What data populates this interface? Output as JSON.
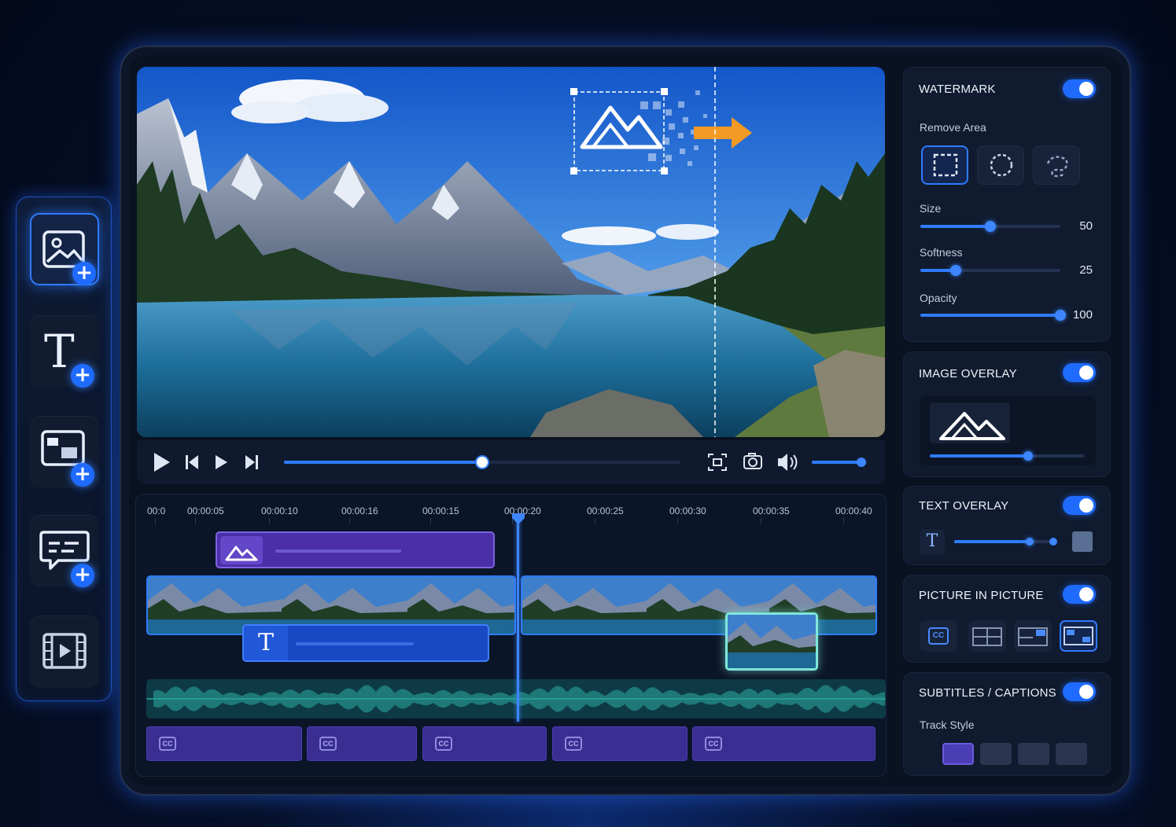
{
  "dock": {
    "items": [
      {
        "name": "add-image",
        "icon": "image-plus-icon"
      },
      {
        "name": "add-text",
        "icon": "text-plus-icon"
      },
      {
        "name": "add-picture-in-picture",
        "icon": "pip-plus-icon"
      },
      {
        "name": "add-caption",
        "icon": "caption-plus-icon"
      },
      {
        "name": "media-library",
        "icon": "film-icon"
      }
    ]
  },
  "player": {
    "progress": 0.5,
    "volume": 0.9
  },
  "timeline": {
    "ruler": [
      "00:0",
      "00:00:05",
      "00:00:10",
      "00:00:16",
      "00:00:15",
      "00:00:20",
      "00:00:25",
      "00:00:30",
      "00:00:35",
      "00:00:40"
    ],
    "playhead_label": "00:00:20",
    "caption_clip_label": "CC"
  },
  "panel": {
    "watermark": {
      "title": "WATERMARK",
      "enabled": true,
      "remove_area_label": "Remove Area",
      "shapes": [
        "rectangle-select-icon",
        "circle-select-icon",
        "lasso-select-icon"
      ],
      "sliders": [
        {
          "label": "Size",
          "value": "50",
          "fraction": 0.5
        },
        {
          "label": "Softness",
          "value": "25",
          "fraction": 0.25
        },
        {
          "label": "Opacity",
          "value": "100",
          "fraction": 1.0
        }
      ]
    },
    "image_overlay": {
      "title": "IMAGE OVERLAY",
      "enabled": true,
      "level": 0.64
    },
    "text_overlay": {
      "title": "TEXT OVERLAY",
      "enabled": true,
      "text_icon_glyph": "T",
      "level": 0.77
    },
    "pip": {
      "title": "PICTURE IN PICTURE",
      "enabled": true,
      "cc_label": "CC"
    },
    "subtitles": {
      "title": "SUBTITLES / CAPTIONS",
      "enabled": true,
      "track_style_label": "Track Style"
    }
  },
  "colors": {
    "accent": "#1f6bff",
    "caption_clip": "#3b2e92",
    "image_clip": "#4a2fa8",
    "text_clip": "#1848c4",
    "audio_wave": "#2aa39b"
  }
}
